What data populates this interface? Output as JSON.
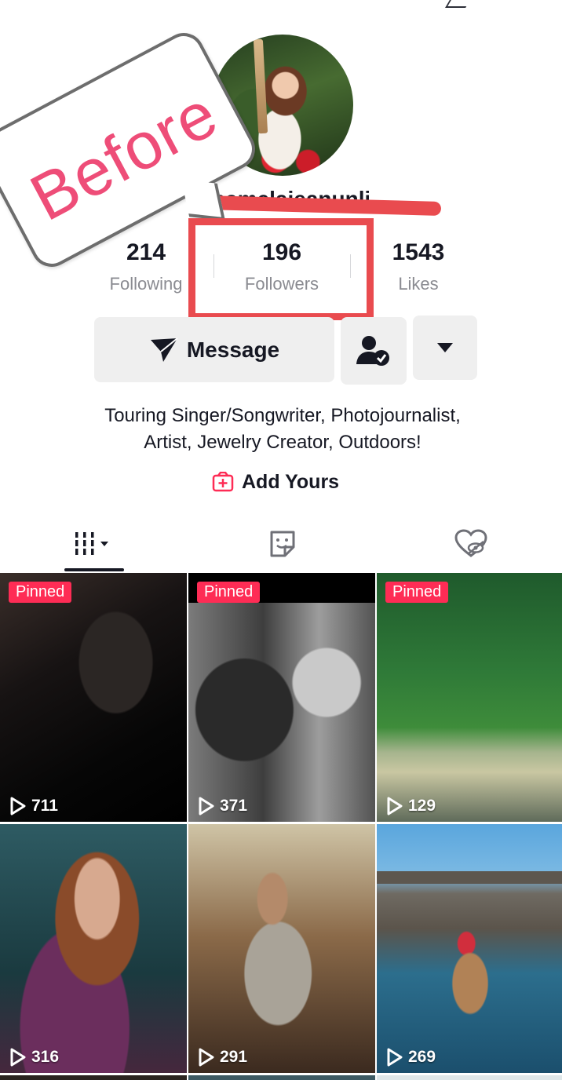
{
  "overlay": {
    "sticker_text": "Before"
  },
  "profile": {
    "username": "pamelajeanunlimited"
  },
  "stats": {
    "following": {
      "value": "214",
      "label": "Following"
    },
    "followers": {
      "value": "196",
      "label": "Followers"
    },
    "likes": {
      "value": "1543",
      "label": "Likes"
    }
  },
  "actions": {
    "message_label": "Message",
    "friend_icon": "person-check-icon",
    "more_icon": "caret-down-icon"
  },
  "bio": {
    "line1": "Touring Singer/Songwriter, Photojournalist,",
    "line2": "Artist, Jewelry Creator, Outdoors!"
  },
  "add_yours": {
    "label": "Add Yours"
  },
  "tabs": [
    {
      "name": "videos",
      "icon": "grid-videos-icon",
      "active": true
    },
    {
      "name": "reposts",
      "icon": "sticker-face-icon",
      "active": false
    },
    {
      "name": "liked",
      "icon": "hidden-heart-icon",
      "active": false
    }
  ],
  "videos": [
    {
      "pinned": "Pinned",
      "views": "711"
    },
    {
      "pinned": "Pinned",
      "views": "371"
    },
    {
      "pinned": "Pinned",
      "views": "129"
    },
    {
      "pinned": "",
      "views": "316"
    },
    {
      "pinned": "",
      "views": "291"
    },
    {
      "pinned": "",
      "views": "269"
    }
  ],
  "colors": {
    "accent_pink": "#fe2c55",
    "annotation_red": "#e94b4f",
    "sticker_pink": "#ee4d78",
    "button_bg": "#efefef"
  }
}
